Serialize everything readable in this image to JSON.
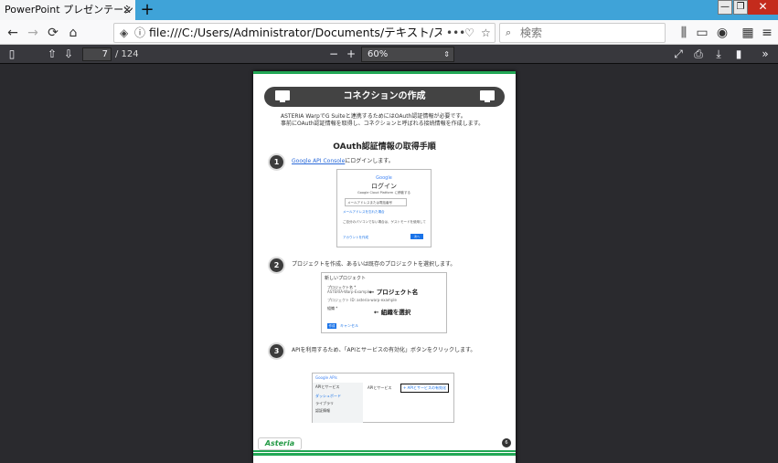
{
  "browser": {
    "tab_title": "PowerPoint プレゼンテーション - スタ",
    "tab_close": "✕",
    "new_tab": "+",
    "url": "file:///C:/Users/Administrator/Documents/テキスト/スタートガイド_GSuite.p",
    "url_more": "•••",
    "search_placeholder": "検索",
    "window_controls": [
      "—",
      "❐",
      "✕"
    ]
  },
  "pdf_toolbar": {
    "page_current": "7",
    "page_total": "/ 124",
    "zoom_out": "−",
    "zoom_in": "+",
    "zoom_value": "60%"
  },
  "slide": {
    "title": "コネクションの作成",
    "intro_line1": "ASTERIA WarpでG Suiteと連携するためにはOAuth認証情報が必要です。",
    "intro_line2": "事前にOAuth認証情報を取得し、コネクションと呼ばれる接続情報を作成します。",
    "section_heading": "OAuth認証情報の取得手順",
    "steps": [
      {
        "num": "1",
        "link": "Google API Console",
        "text": "にログインします。"
      },
      {
        "num": "2",
        "text": "プロジェクトを作成、あるいは既存のプロジェクトを選択します。"
      },
      {
        "num": "3",
        "text": "APIを利用するため、「APIとサービスの有効化」ボタンをクリックします。"
      }
    ],
    "login_shot": {
      "google": "Google",
      "title": "ログイン",
      "subtitle": "Google Cloud Platform に移動する",
      "field_hint": "メールアドレスまたは電話番号",
      "forgot": "メールアドレスを忘れた場合",
      "note": "ご自分のパソコンでない場合は、ゲストモードを使用して",
      "create": "アカウントを作成",
      "next": "次へ"
    },
    "project_shot": {
      "header": "新しいプロジェクト",
      "name_label": "プロジェクト名 *",
      "name_value": "ASTERIA-Warp-Example",
      "callout_name": "← プロジェクト名",
      "id_label": "プロジェクト ID: asteria-warp-example",
      "org_label": "組織 *",
      "callout_org": "← 組織を選択",
      "create": "作成",
      "cancel": "キャンセル"
    },
    "api_shot": {
      "header": "Google APIs",
      "menu_title": "APIとサービス",
      "item1": "ダッシュボード",
      "item2": "ライブラリ",
      "item3": "認証情報",
      "enable_button": "+ APIとサービスの有効化"
    },
    "logo": "Asteria",
    "page_badge": "6"
  }
}
